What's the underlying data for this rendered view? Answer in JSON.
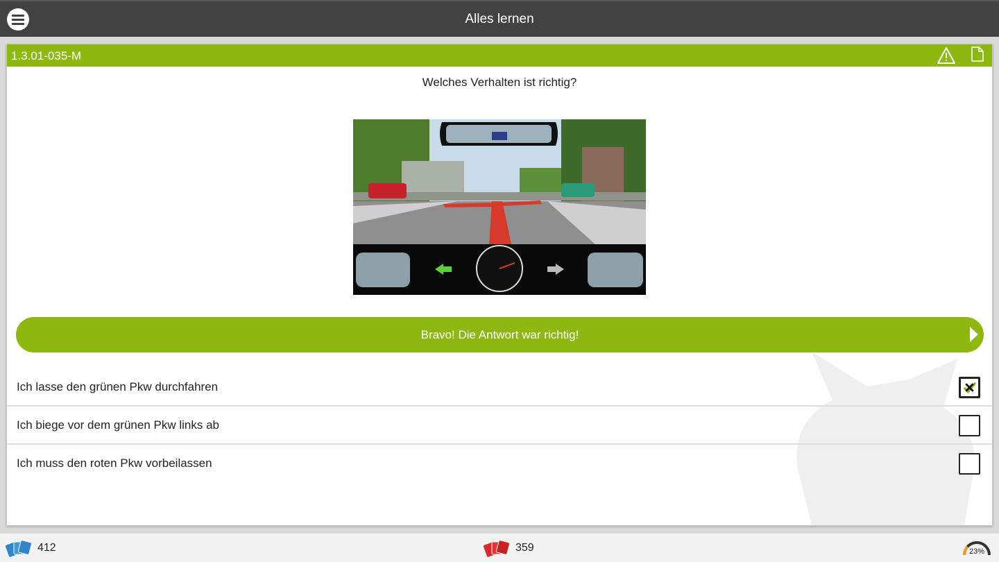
{
  "header": {
    "title": "Alles lernen",
    "menu_icon": "menu-icon"
  },
  "question": {
    "id": "1.3.01-035-M",
    "text": "Welches Verhalten ist richtig?",
    "icons": [
      "warning-icon",
      "document-icon"
    ]
  },
  "feedback": {
    "text": "Bravo! Die Antwort war richtig!",
    "color": "#8cb80f"
  },
  "answers": [
    {
      "text": "Ich lasse den grünen Pkw durchfahren",
      "checked": true
    },
    {
      "text": "Ich biege vor dem grünen Pkw links ab",
      "checked": false
    },
    {
      "text": "Ich muss den roten Pkw vorbeilassen",
      "checked": false
    }
  ],
  "footer": {
    "left_count": "412",
    "middle_count": "359",
    "progress_label": "23%",
    "progress_fraction": 0.23
  },
  "colors": {
    "accent": "#8cb80f",
    "topbar": "#424242"
  }
}
